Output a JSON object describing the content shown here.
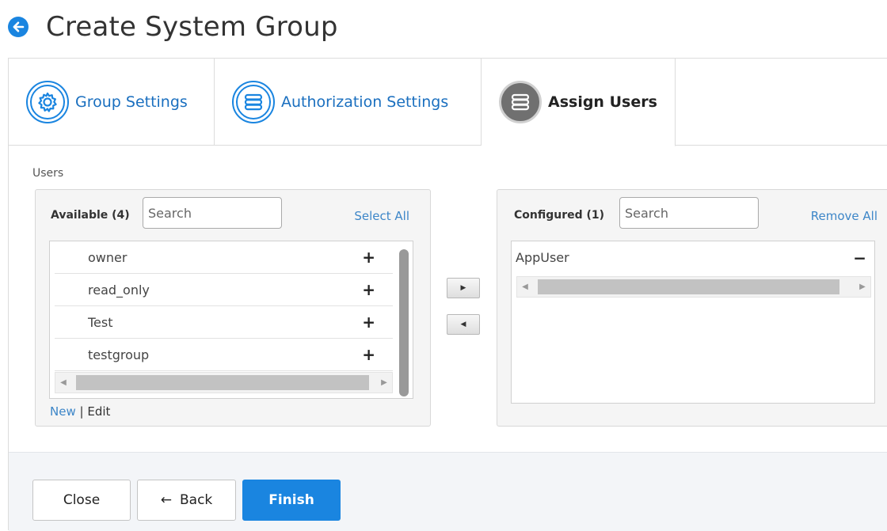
{
  "header": {
    "title": "Create System Group",
    "back_icon": "arrow-left-circle-icon"
  },
  "tabs": [
    {
      "label": "Group Settings",
      "icon": "gear-icon",
      "active": false
    },
    {
      "label": "Authorization Settings",
      "icon": "database-stack-icon",
      "active": false
    },
    {
      "label": "Assign Users",
      "icon": "database-stack-icon",
      "active": true
    }
  ],
  "users_section": {
    "label": "Users",
    "available": {
      "title": "Available (4)",
      "search_placeholder": "Search",
      "select_all_label": "Select All",
      "items": [
        {
          "label": "owner",
          "action": "+"
        },
        {
          "label": "read_only",
          "action": "+"
        },
        {
          "label": "Test",
          "action": "+"
        },
        {
          "label": "testgroup",
          "action": "+"
        }
      ],
      "new_label": "New",
      "separator": "|",
      "edit_label": "Edit"
    },
    "configured": {
      "title": "Configured (1)",
      "search_placeholder": "Search",
      "remove_all_label": "Remove All",
      "items": [
        {
          "label": "AppUser",
          "action": "−"
        }
      ]
    }
  },
  "actions": {
    "close_label": "Close",
    "back_label": "Back",
    "back_arrow": "←",
    "finish_label": "Finish"
  },
  "colors": {
    "accent": "#1a85e0",
    "link": "#3d86c8",
    "active_icon": "#707070"
  }
}
